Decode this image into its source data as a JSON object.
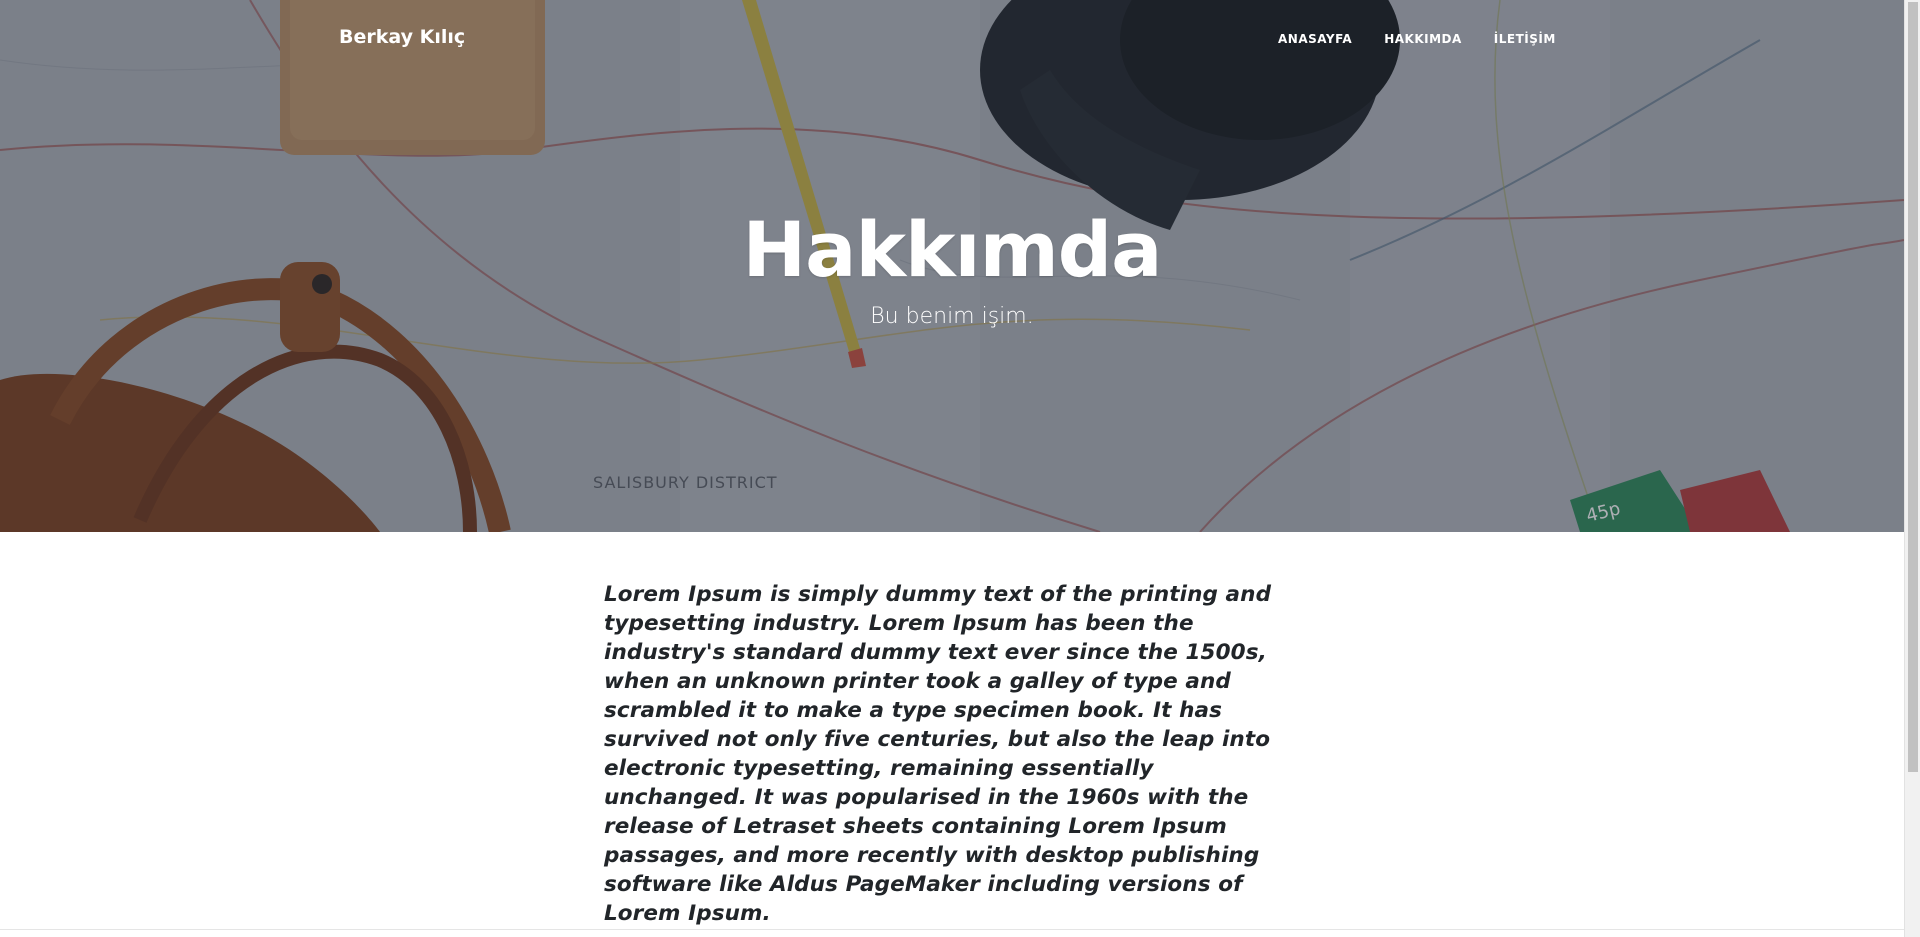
{
  "navbar": {
    "brand": "Berkay Kılıç",
    "links": [
      "ANASAYFA",
      "HAKKIMDA",
      "İLETİŞİM"
    ]
  },
  "hero": {
    "heading": "Hakkımda",
    "subheading": "Bu benim işim.",
    "background_image_text": "SALISBURY DISTRICT"
  },
  "content": {
    "paragraph": "Lorem Ipsum is simply dummy text of the printing and typesetting industry. Lorem Ipsum has been the industry's standard dummy text ever since the 1500s, when an unknown printer took a galley of type and scrambled it to make a type specimen book. It has survived not only five centuries, but also the leap into electronic typesetting, remaining essentially unchanged. It was popularised in the 1960s with the release of Letraset sheets containing Lorem Ipsum passages, and more recently with desktop publishing software like Aldus PageMaker including versions of Lorem Ipsum."
  },
  "colors": {
    "hero_overlay": "#3c4250",
    "text_dark": "#212529",
    "white": "#ffffff",
    "leather": "#8a4a22",
    "notebook": "#b98f64"
  }
}
